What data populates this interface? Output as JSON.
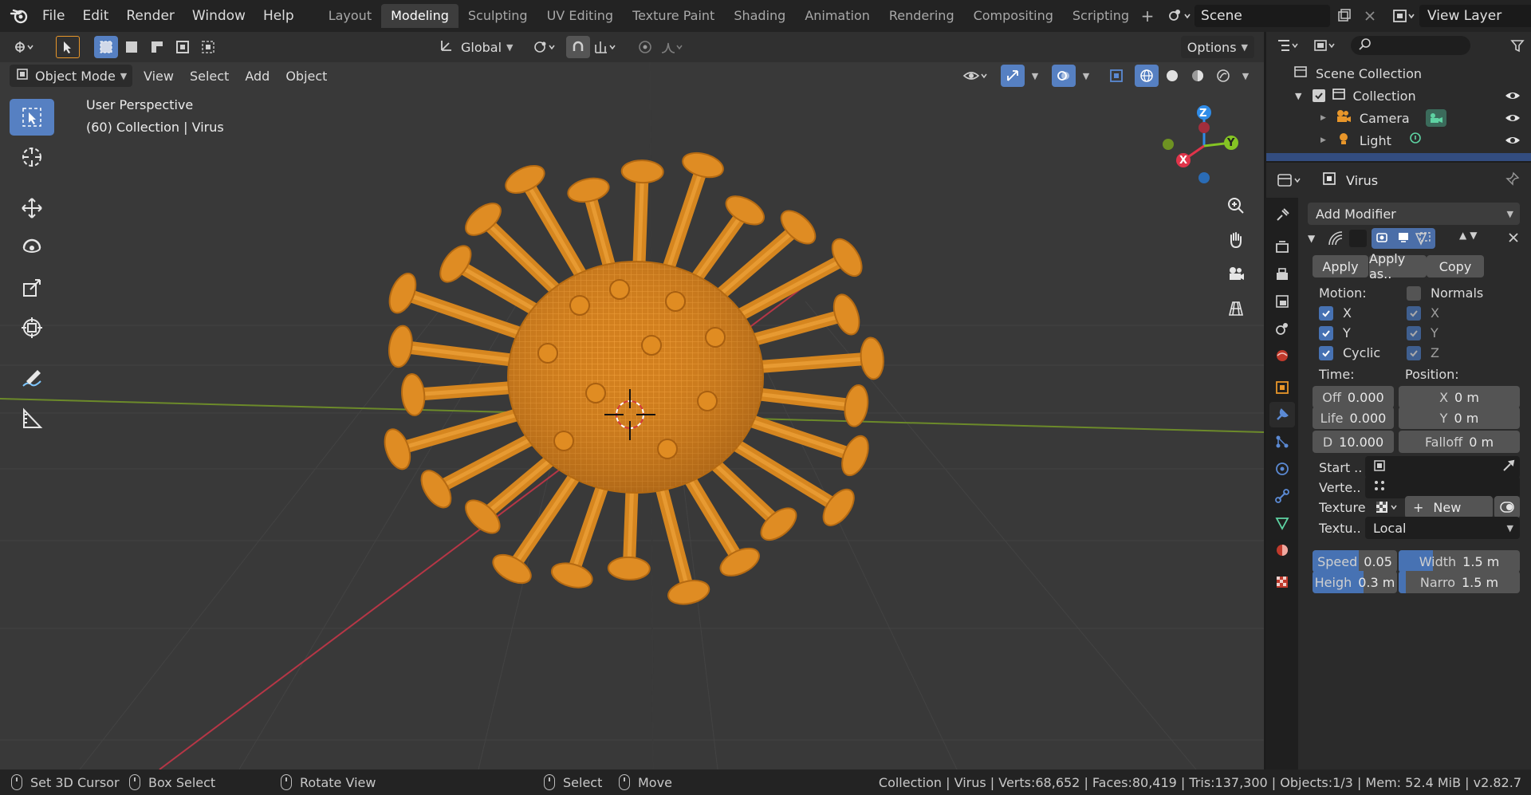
{
  "menu": [
    "File",
    "Edit",
    "Render",
    "Window",
    "Help"
  ],
  "workspaces": [
    {
      "label": "Layout",
      "active": false
    },
    {
      "label": "Modeling",
      "active": true
    },
    {
      "label": "Sculpting",
      "active": false
    },
    {
      "label": "UV Editing",
      "active": false
    },
    {
      "label": "Texture Paint",
      "active": false
    },
    {
      "label": "Shading",
      "active": false
    },
    {
      "label": "Animation",
      "active": false
    },
    {
      "label": "Rendering",
      "active": false
    },
    {
      "label": "Compositing",
      "active": false
    },
    {
      "label": "Scripting",
      "active": false
    }
  ],
  "scene_name": "Scene",
  "view_layer": "View Layer",
  "tool_header": {
    "orientation": "Global",
    "options_label": "Options"
  },
  "viewport_header": {
    "mode": "Object Mode",
    "menus": [
      "View",
      "Select",
      "Add",
      "Object"
    ]
  },
  "viewport": {
    "perspective": "User Perspective",
    "info": "(60) Collection | Virus"
  },
  "gizmo": {
    "x": "X",
    "y": "Y",
    "z": "Z"
  },
  "colors": {
    "accent": "#4772b3",
    "active_tab": "#5680c2",
    "object": "#e8962a",
    "x_axis": "#e0344a",
    "y_axis": "#85c524",
    "z_axis": "#2f8ce8"
  },
  "outliner": {
    "root": "Scene Collection",
    "rows": [
      {
        "label": "Collection",
        "icon": "collection-icon"
      },
      {
        "label": "Camera",
        "icon": "camera-object-icon"
      },
      {
        "label": "Light",
        "icon": "light-object-icon"
      }
    ]
  },
  "properties": {
    "object_name": "Virus",
    "add_modifier": "Add Modifier",
    "apply": "Apply",
    "apply_as": "Apply as..",
    "copy": "Copy",
    "motion_label": "Motion:",
    "normals_label": "Normals",
    "checks_left": [
      {
        "label": "X",
        "checked": true
      },
      {
        "label": "Y",
        "checked": true
      },
      {
        "label": "Cyclic",
        "checked": true
      }
    ],
    "checks_right": [
      {
        "label": "X",
        "checked": true
      },
      {
        "label": "Y",
        "checked": true
      },
      {
        "label": "Z",
        "checked": true
      }
    ],
    "time_label": "Time:",
    "position_label": "Position:",
    "time_fields": [
      {
        "label": "Off",
        "value": "0.000"
      },
      {
        "label": "Life",
        "value": "0.000"
      },
      {
        "label": "D",
        "value": "10.000"
      }
    ],
    "position_fields": [
      {
        "label": "X",
        "value": "0 m"
      },
      {
        "label": "Y",
        "value": "0 m"
      },
      {
        "label": "Falloff",
        "value": "0 m"
      }
    ],
    "start_label": "Start ..",
    "vertex_label": "Verte..",
    "texture_label": "Texture",
    "texture_new": "New",
    "texture_coords_label": "Textu..",
    "texture_coords_value": "Local",
    "sliders": [
      {
        "label": "Speed",
        "value": "0.05",
        "fill": 0.55
      },
      {
        "label": "Width",
        "value": "1.5 m",
        "fill": 0.28
      },
      {
        "label": "Heigh",
        "value": "0.3 m",
        "fill": 0.6
      },
      {
        "label": "Narro",
        "value": "1.5 m",
        "fill": 0.06
      }
    ]
  },
  "status": {
    "set_cursor": "Set 3D Cursor",
    "box_select": "Box Select",
    "rotate_view": "Rotate View",
    "select": "Select",
    "move": "Move",
    "stats": "Collection | Virus | Verts:68,652 | Faces:80,419 | Tris:137,300 | Objects:1/3 | Mem: 52.4 MiB | v2.82.7"
  }
}
